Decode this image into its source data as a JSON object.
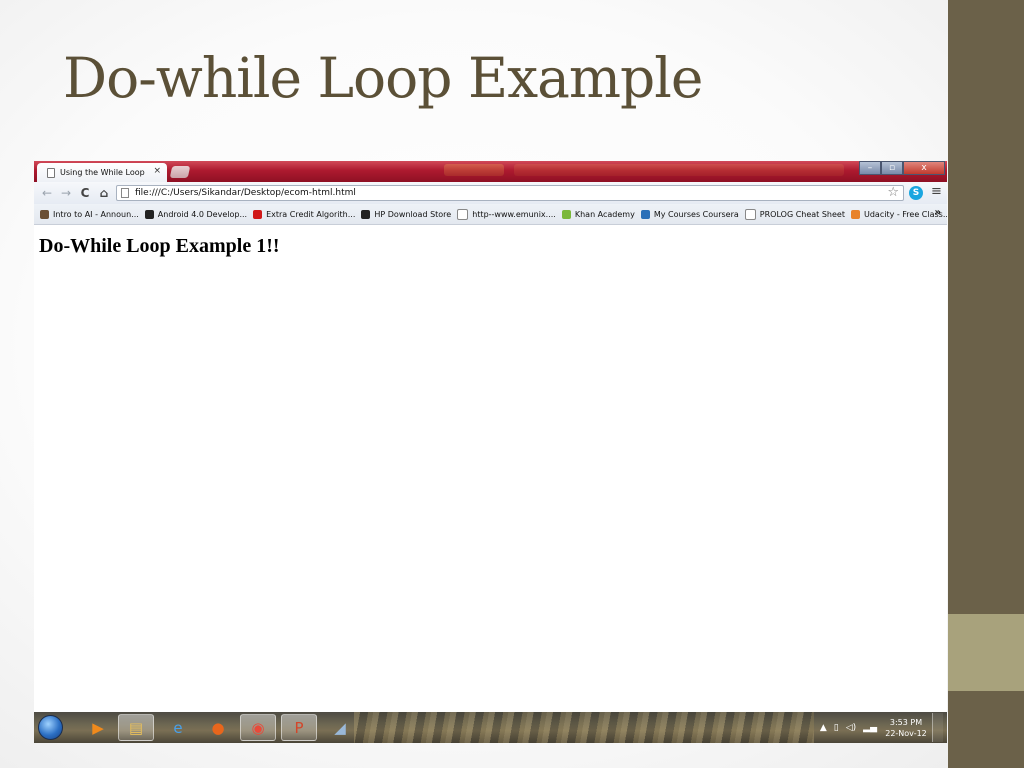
{
  "slide": {
    "title": "Do-while Loop Example"
  },
  "browser": {
    "tab": {
      "title": "Using the While Loop",
      "close_glyph": "×"
    },
    "window_controls": {
      "minimize": "–",
      "maximize": "▫",
      "close": "x"
    },
    "toolbar": {
      "back": "←",
      "forward": "→",
      "reload": "C",
      "home": "⌂",
      "url": "file:///C:/Users/Sikandar/Desktop/ecom-html.html",
      "star": "☆",
      "menu": "≡"
    },
    "bookmarks": [
      {
        "label": "Intro to AI - Announ...",
        "icon": "ai-icon",
        "color": "#6b4f35"
      },
      {
        "label": "Android 4.0 Develop...",
        "icon": "android-icon",
        "color": "#222222"
      },
      {
        "label": "Extra Credit Algorith...",
        "icon": "udacity-u-icon",
        "color": "#d01818"
      },
      {
        "label": "HP Download Store",
        "icon": "hp-icon",
        "color": "#222222"
      },
      {
        "label": "http--www.emunix....",
        "icon": "page-icon",
        "color": "#ffffff"
      },
      {
        "label": "Khan Academy",
        "icon": "leaf-icon",
        "color": "#7ab83a"
      },
      {
        "label": "My Courses Coursera",
        "icon": "coursera-icon",
        "color": "#2a6fb8"
      },
      {
        "label": "PROLOG Cheat Sheet",
        "icon": "page-icon",
        "color": "#ffffff"
      },
      {
        "label": "Udacity - Free Class...",
        "icon": "udacity-u-icon",
        "color": "#e8822a"
      }
    ],
    "bookmarks_more": "»",
    "content": {
      "heading": "Do-While Loop Example 1!!"
    }
  },
  "taskbar": {
    "items": [
      {
        "name": "media-player-icon",
        "glyph": "▶",
        "color": "#f08a1c"
      },
      {
        "name": "file-explorer-icon",
        "glyph": "▤",
        "color": "#e9c05a"
      },
      {
        "name": "internet-explorer-icon",
        "glyph": "e",
        "color": "#4aa0e8"
      },
      {
        "name": "firefox-icon",
        "glyph": "●",
        "color": "#e8661c"
      },
      {
        "name": "chrome-icon",
        "glyph": "◉",
        "color": "#e84a3a"
      },
      {
        "name": "powerpoint-icon",
        "glyph": "P",
        "color": "#d2462a"
      },
      {
        "name": "app-icon",
        "glyph": "◢",
        "color": "#9ab8d8"
      }
    ],
    "tray": {
      "arrow": "▲",
      "time": "3:53 PM",
      "date": "22-Nov-12"
    }
  }
}
